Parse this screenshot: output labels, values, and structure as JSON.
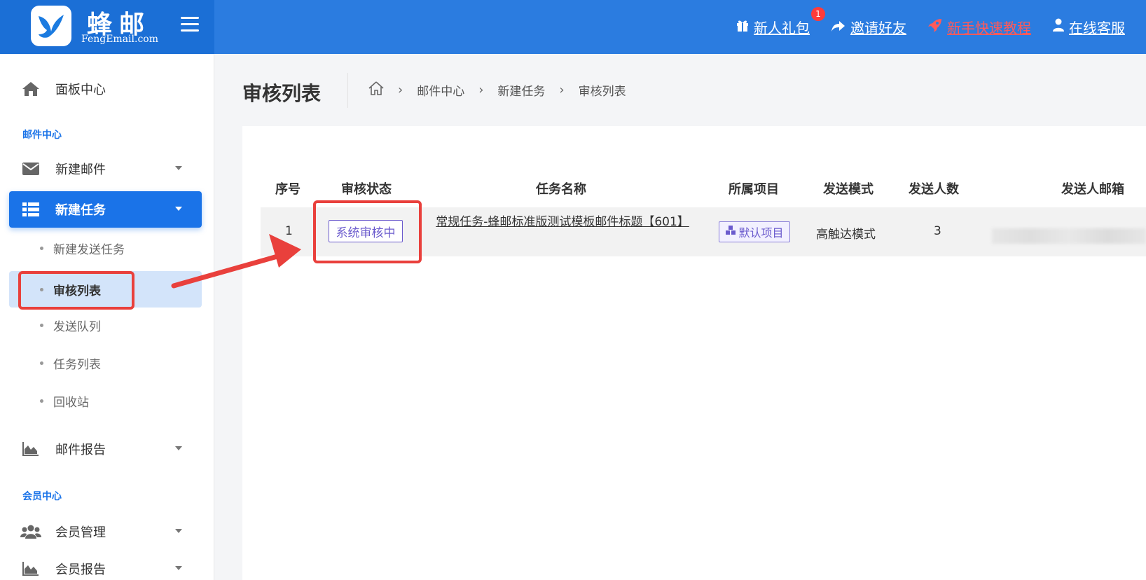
{
  "header": {
    "brand_name": "蜂邮",
    "brand_sub": "FengEmail.com",
    "links": {
      "gift": "新人礼包",
      "gift_badge": "1",
      "invite": "邀请好友",
      "tutorial": "新手快速教程",
      "support": "在线客服"
    },
    "colors": {
      "bar": "#2b7ce0",
      "brand": "#1b6fd6",
      "tutorial": "#ff5a5a"
    }
  },
  "sidebar": {
    "dashboard": "面板中心",
    "section_mail": "邮件中心",
    "new_mail": "新建邮件",
    "new_task": "新建任务",
    "sub_items": [
      "新建发送任务",
      "审核列表",
      "发送队列",
      "任务列表",
      "回收站"
    ],
    "mail_report": "邮件报告",
    "section_member": "会员中心",
    "member_manage": "会员管理",
    "member_report": "会员报告"
  },
  "page": {
    "title": "审核列表",
    "breadcrumb": [
      "邮件中心",
      "新建任务",
      "审核列表"
    ]
  },
  "table": {
    "headers": [
      "序号",
      "审核状态",
      "任务名称",
      "所属项目",
      "发送模式",
      "发送人数",
      "发送人邮箱"
    ],
    "row": {
      "index": "1",
      "status": "系统审核中",
      "task_name": "常规任务-蜂邮标准版测试模板邮件标题【601】",
      "project": "默认项目",
      "mode": "高触达模式",
      "count": "3"
    }
  },
  "icons": [
    "logo-bird-icon",
    "menu-icon",
    "gift-icon",
    "share-icon",
    "rocket-icon",
    "user-icon",
    "home-icon",
    "envelope-icon",
    "list-icon",
    "chart-icon",
    "users-icon",
    "cube-icon"
  ]
}
